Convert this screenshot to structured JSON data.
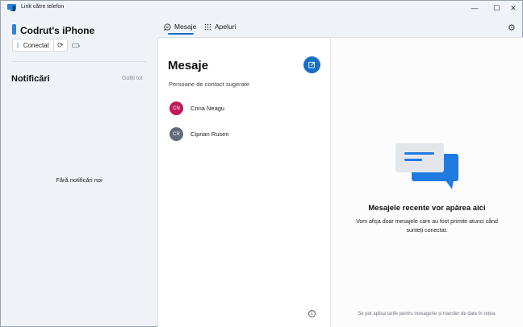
{
  "window": {
    "title": "Link către telefon",
    "minimize": "—",
    "maximize": "☐",
    "close": "✕"
  },
  "sidebar": {
    "device_name": "Codrut's iPhone",
    "connection_status": "Conectat",
    "notifications_title": "Notificări",
    "clear_all": "Goliți tot",
    "empty_text": "Fără notificări noi"
  },
  "tabs": [
    {
      "label": "Mesaje",
      "icon": "chat-bubble-icon",
      "selected": true
    },
    {
      "label": "Apeluri",
      "icon": "dialpad-icon",
      "selected": false
    }
  ],
  "messages": {
    "heading": "Mesaje",
    "suggested_label": "Persoane de contact sugerate",
    "contacts": [
      {
        "initials": "CN",
        "name": "Crina Neagu",
        "color": "#c2185b"
      },
      {
        "initials": "CR",
        "name": "Ciprian Rusen",
        "color": "#5f6b78"
      }
    ]
  },
  "conversation": {
    "empty_title": "Mesajele recente vor apărea aici",
    "empty_desc": "Vom afișa doar mesajele care au fost primite atunci când sunteți conectat.",
    "footnote": "Se pot aplica tarife pentru mesagerie și transfer de date în rețea."
  },
  "colors": {
    "accent": "#1a6fc4",
    "bubble_blue": "#1f7be0",
    "bubble_grey": "#e3e7ec"
  }
}
